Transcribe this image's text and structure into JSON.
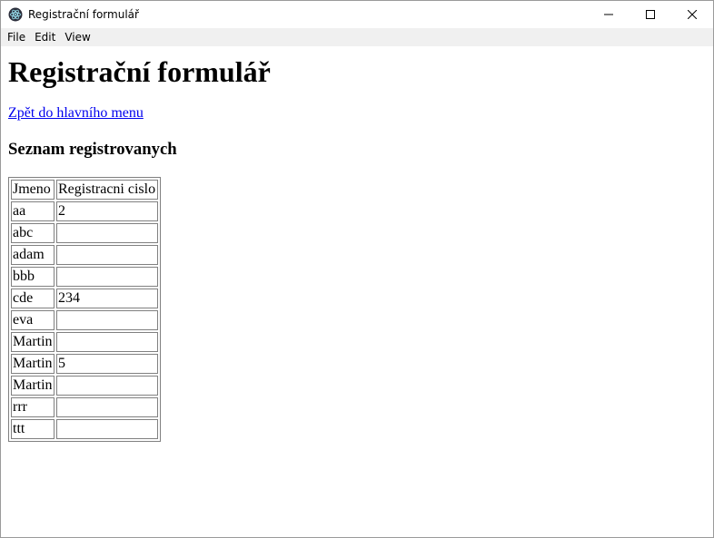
{
  "window": {
    "title": "Registrační formulář"
  },
  "menu": {
    "items": [
      "File",
      "Edit",
      "View"
    ]
  },
  "page": {
    "heading": "Registrační formulář",
    "back_link": "Zpět do hlavního menu",
    "section_heading": "Seznam registrovanych"
  },
  "table": {
    "headers": [
      "Jmeno",
      "Registracni cislo"
    ],
    "rows": [
      [
        "aa",
        "2"
      ],
      [
        "abc",
        ""
      ],
      [
        "adam",
        ""
      ],
      [
        "bbb",
        ""
      ],
      [
        "cde",
        "234"
      ],
      [
        "eva",
        ""
      ],
      [
        "Martin",
        ""
      ],
      [
        "Martin",
        "5"
      ],
      [
        "Martin",
        ""
      ],
      [
        "rrr",
        ""
      ],
      [
        "ttt",
        ""
      ]
    ]
  }
}
